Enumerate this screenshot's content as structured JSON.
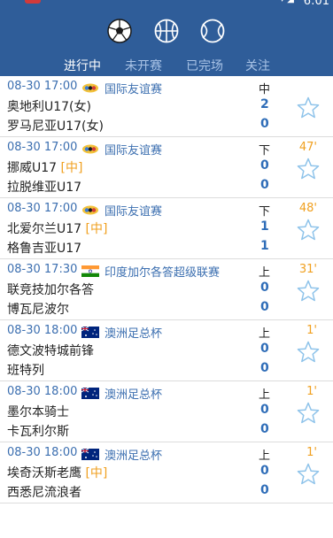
{
  "statusbar": {
    "time": "6:01",
    "icons": "▾ ◢"
  },
  "sports": [
    {
      "name": "soccer",
      "icon": "soccer-ball-icon",
      "active": true
    },
    {
      "name": "basketball",
      "icon": "basketball-icon",
      "active": false
    },
    {
      "name": "tennis",
      "icon": "tennis-ball-icon",
      "active": false
    }
  ],
  "tabs": [
    {
      "label": "进行中",
      "active": true
    },
    {
      "label": "未开赛",
      "active": false
    },
    {
      "label": "已完场",
      "active": false
    },
    {
      "label": "关注",
      "active": false
    }
  ],
  "colors": {
    "header": "#2f5d99",
    "accent": "#f0a020",
    "score": "#2f6db8",
    "link": "#3c6fb0"
  },
  "matches": [
    {
      "time": "08-30 17:00",
      "flag": "international-flag-icon",
      "league": "国际友谊赛",
      "status": "中",
      "minute": "",
      "home": "奥地利U17(女)",
      "home_tag": "",
      "away": "罗马尼亚U17(女)",
      "away_tag": "",
      "home_score": "2",
      "away_score": "0"
    },
    {
      "time": "08-30 17:00",
      "flag": "international-flag-icon",
      "league": "国际友谊赛",
      "status": "下",
      "minute": "47'",
      "home": "挪威U17 ",
      "home_tag": "[中]",
      "away": "拉脱维亚U17",
      "away_tag": "",
      "home_score": "0",
      "away_score": "0"
    },
    {
      "time": "08-30 17:00",
      "flag": "international-flag-icon",
      "league": "国际友谊赛",
      "status": "下",
      "minute": "48'",
      "home": "北爱尔兰U17 ",
      "home_tag": "[中]",
      "away": "格鲁吉亚U17",
      "away_tag": "",
      "home_score": "1",
      "away_score": "1"
    },
    {
      "time": "08-30 17:30",
      "flag": "india-flag-icon",
      "league": "印度加尔各答超级联赛",
      "status": "上",
      "minute": "31'",
      "home": "联竞技加尔各答",
      "home_tag": "",
      "away": "博瓦尼波尔",
      "away_tag": "",
      "home_score": "0",
      "away_score": "0"
    },
    {
      "time": "08-30 18:00",
      "flag": "australia-flag-icon",
      "league": "澳洲足总杯",
      "status": "上",
      "minute": "1'",
      "home": "德文波特城前锋",
      "home_tag": "",
      "away": "班特列",
      "away_tag": "",
      "home_score": "0",
      "away_score": "0"
    },
    {
      "time": "08-30 18:00",
      "flag": "australia-flag-icon",
      "league": "澳洲足总杯",
      "status": "上",
      "minute": "1'",
      "home": "墨尔本骑士",
      "home_tag": "",
      "away": "卡瓦利尔斯",
      "away_tag": "",
      "home_score": "0",
      "away_score": "0"
    },
    {
      "time": "08-30 18:00",
      "flag": "australia-flag-icon",
      "league": "澳洲足总杯",
      "status": "上",
      "minute": "1'",
      "home": "埃奇沃斯老鹰 ",
      "home_tag": "[中]",
      "away": "西悉尼流浪者",
      "away_tag": "",
      "home_score": "0",
      "away_score": "0"
    }
  ]
}
